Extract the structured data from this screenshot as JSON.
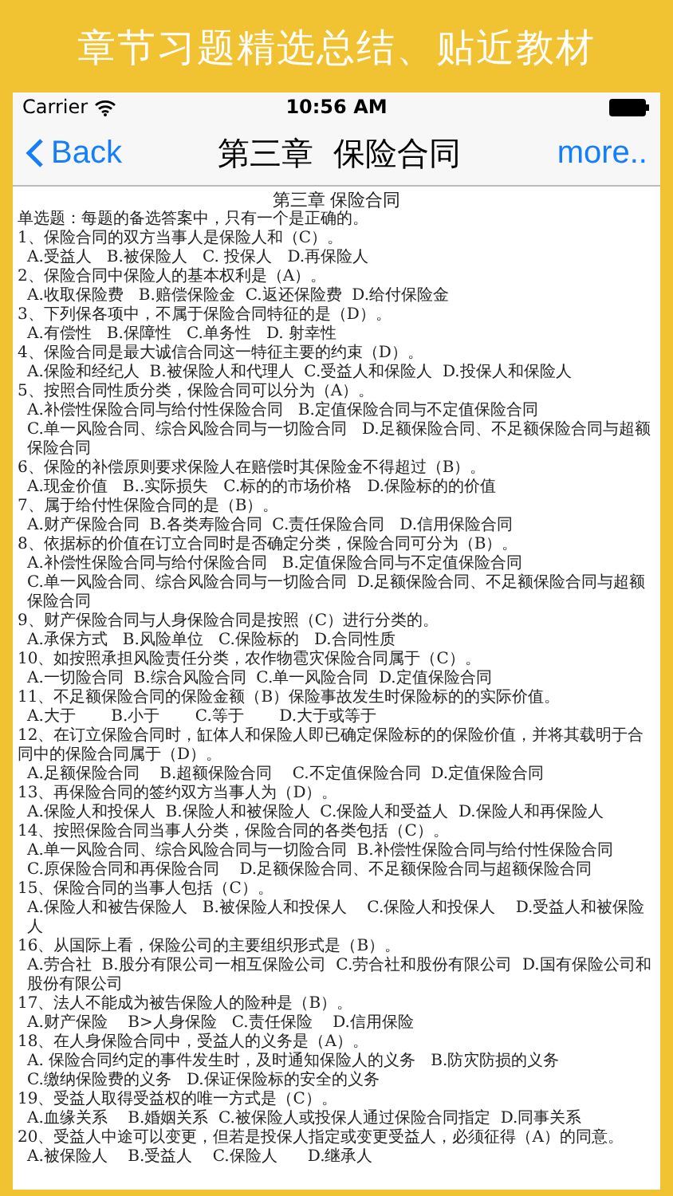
{
  "banner": {
    "heading": "章节习题精选总结、贴近教材"
  },
  "status_bar": {
    "carrier": "Carrier",
    "time": "10:56 AM"
  },
  "nav_bar": {
    "back": "Back",
    "title": "第三章  保险合同",
    "more": "more.."
  },
  "document": {
    "title": "第三章 保险合同",
    "intro": "单选题：每题的备选答案中，只有一个是正确的。",
    "questions": [
      {
        "stem": "1、保险合同的双方当事人是保险人和（C）。",
        "option_lines": [
          "A.受益人   B.被保险人   C. 投保人   D.再保险人"
        ]
      },
      {
        "stem": "2、保险合同中保险人的基本权利是（A）。",
        "option_lines": [
          "A.收取保险费   B.赔偿保险金  C.返还保险费  D.给付保险金"
        ]
      },
      {
        "stem": "3、下列保各项中，不属于保险合同特征的是（D）。",
        "option_lines": [
          "A.有偿性   B.保障性   C.单务性   D. 射幸性"
        ]
      },
      {
        "stem": "4、保险合同是最大诚信合同这一特征主要的约束（D）。",
        "option_lines": [
          "A.保险和经纪人  B.被保险人和代理人  C.受益人和保险人  D.投保人和保险人"
        ]
      },
      {
        "stem": "5、按照合同性质分类，保险合同可以分为（A）。",
        "option_lines": [
          "A.补偿性保险合同与给付性保险合同   B.定值保险合同与不定值保险合同",
          "C.单一风险合同、综合风险合同与一切险合同   D.足额保险合同、不足额保险合同与超额保险合同"
        ]
      },
      {
        "stem": "6、保险的补偿原则要求保险人在赔偿时其保险金不得超过（B）。",
        "option_lines": [
          "A.现金价值   B..实际损失   C.标的的市场价格   D.保险标的的价值"
        ]
      },
      {
        "stem": "7、属于给付性保险合同的是（B）。",
        "option_lines": [
          "A.财产保险合同  B.各类寿险合同  C.责任保险合同   D.信用保险合同"
        ]
      },
      {
        "stem": "8、依据标的价值在订立合同时是否确定分类，保险合同可分为（B）。",
        "option_lines": [
          "A.补偿性保险合同与给付保险合同   B.定值保险合同与不定值保险合同",
          "C.单一风险合同、综合风险合同与一切险合同  D.足额保险合同、不足额保险合同与超额保险合同"
        ]
      },
      {
        "stem": "9、财产保险合同与人身保险合同是按照（C）进行分类的。",
        "option_lines": [
          "A.承保方式   B.风险单位   C.保险标的   D.合同性质"
        ]
      },
      {
        "stem": "10、如按照承担风险责任分类，农作物雹灾保险合同属于（C）。",
        "option_lines": [
          "A.一切险合同  B.综合风险合同  C.单一风险合同  D.定值保险合同"
        ]
      },
      {
        "stem": "11、不足额保险合同的保险金额（B）保险事故发生时保险标的的实际价值。",
        "option_lines": [
          "A.大于       B.小于       C.等于       D.大于或等于"
        ]
      },
      {
        "stem": "12、在订立保险合同时，缸体人和保险人即已确定保险标的的保险价值，并将其载明于合同中的保险合同属于（D）。",
        "option_lines": [
          "A.足额保险合同    B.超额保险合同    C.不定值保险合同  D.定值保险合同"
        ]
      },
      {
        "stem": "13、再保险合同的签约双方当事人为（D）。",
        "option_lines": [
          "A.保险人和投保人  B.保险人和被保险人  C.保险人和受益人  D.保险人和再保险人"
        ]
      },
      {
        "stem": "14、按照保险合同当事人分类，保险合同的各类包括（C）。",
        "option_lines": [
          "A.单一风险合同、综合风险合同与一切险合同  B.补偿性保险合同与给付性保险合同",
          "C.原保险合同和再保险合同    D.足额保险合同、不足额保险合同与超额保险合同"
        ]
      },
      {
        "stem": "15、保险合同的当事人包括（C）。",
        "option_lines": [
          "A.保险人和被告保险人   B.被保险人和投保人    C.保险人和投保人    D.受益人和被保险人"
        ]
      },
      {
        "stem": "16、从国际上看，保险公司的主要组织形式是（B）。",
        "option_lines": [
          "A.劳合社  B.股分有限公司一相互保险公司  C.劳合社和股份有限公司  D.国有保险公司和股份有限公司"
        ]
      },
      {
        "stem": "17、法人不能成为被告保险人的险种是（B）。",
        "option_lines": [
          "A.财产保险    B>人身保险   C.责任保险    D.信用保险"
        ]
      },
      {
        "stem": "18、在人身保险合同中，受益人的义务是（A）。",
        "option_lines": [
          "A. 保险合同约定的事件发生时，及时通知保险人的义务   B.防灾防损的义务",
          "C.缴纳保险费的义务   D.保证保险标的安全的义务"
        ]
      },
      {
        "stem": "19、受益人取得受益权的唯一方式是（C）。",
        "option_lines": [
          "A.血缘关系    B.婚姻关系  C.被保险人或投保人通过保险合同指定  D.同事关系"
        ]
      },
      {
        "stem": "20、受益人中途可以变更，但若是投保人指定或变更受益人，必须征得（A）的同意。",
        "option_lines": [
          "A.被保险人    B.受益人    C.保险人      D.继承人"
        ]
      }
    ]
  }
}
